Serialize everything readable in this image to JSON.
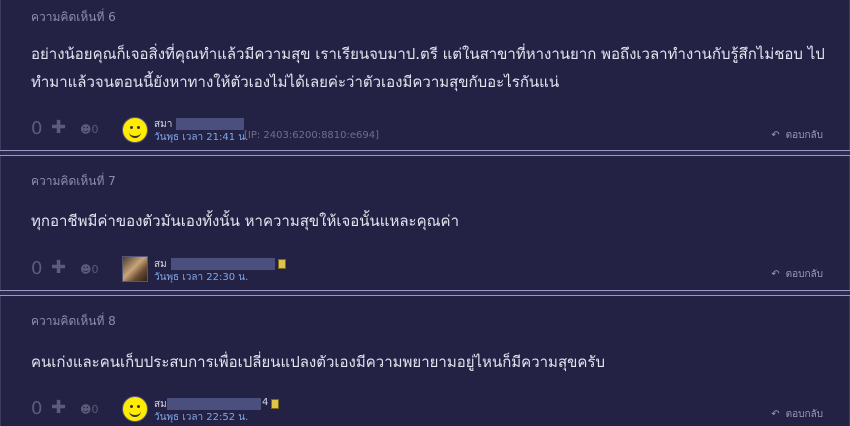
{
  "comments": [
    {
      "header": "ความคิดเห็นที่ 6",
      "text": "อย่างน้อยคุณก็เจอสิ่งที่คุณทำแล้วมีความสุข เราเรียนจบมาป.ตรี แต่ในสาขาที่หางานยาก พอถึงเวลาทำงานกับรู้สึกไม่ชอบ ไปทำมาแล้วจนตอนนี้ยังหาทางให้ตัวเองไม่ได้เลยค่ะว่าตัวเองมีความสุขกับอะไรกันแน่",
      "votes": "0",
      "emotions": "0",
      "user": "สมา",
      "date": "วันพุธ เวลา 21:41 น.",
      "ip": "[IP: 2403:6200:8810:e694]",
      "reply": "ตอบกลับ",
      "avatar": "smiley-avatar"
    },
    {
      "header": "ความคิดเห็นที่ 7",
      "text": "ทุกอาชีพมีค่าของตัวมันเองทั้งนั้น หาความสุขให้เจอนั้นแหละคุณค่า",
      "votes": "0",
      "emotions": "0",
      "user": "สม",
      "date": "วันพุธ เวลา 22:30 น.",
      "reply": "ตอบกลับ",
      "avatar": "photo-avatar"
    },
    {
      "header": "ความคิดเห็นที่ 8",
      "text": "คนเก่งและคนเก็บประสบการเพื่อเปลี่ยนแปลงตัวเองมีความพยายามอยู่ไหนก็มีความสุขครับ",
      "votes": "0",
      "emotions": "0",
      "user": "สม",
      "user_suffix": "4",
      "date": "วันพุธ เวลา 22:52 น.",
      "reply": "ตอบกลับ",
      "avatar": "smiley-avatar"
    }
  ],
  "colors": {
    "background": "#242244",
    "text": "#e4e4f0",
    "date": "#7fa7e8",
    "badge": "#e0c44a"
  }
}
